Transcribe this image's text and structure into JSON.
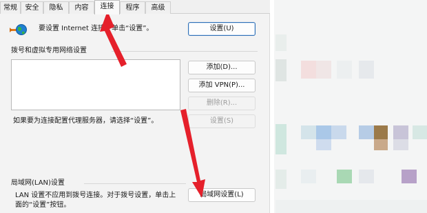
{
  "tabs": [
    {
      "label": "常规"
    },
    {
      "label": "安全"
    },
    {
      "label": "隐私"
    },
    {
      "label": "内容"
    },
    {
      "label": "连接"
    },
    {
      "label": "程序"
    },
    {
      "label": "高级"
    }
  ],
  "active_tab": "连接",
  "setup": {
    "text": "要设置 Internet 连接，单击“设置”。",
    "button": "设置(U)"
  },
  "dialup": {
    "heading": "拨号和虚拟专用网络设置",
    "add_button": "添加(D)...",
    "add_vpn_button": "添加 VPN(P)...",
    "remove_button": "删除(R)...",
    "settings_button": "设置(S)",
    "proxy_hint": "如果要为连接配置代理服务器，请选择“设置”。"
  },
  "lan": {
    "heading": "局域网(LAN)设置",
    "description": "LAN 设置不应用到拨号连接。对于拨号设置，单击上面的“设置”按钮。",
    "button": "局域网设置(L)"
  },
  "colors": {
    "arrow": "#e5202b",
    "primary_border": "#2f6fb5"
  },
  "icons": [
    "internet-globe-icon"
  ]
}
